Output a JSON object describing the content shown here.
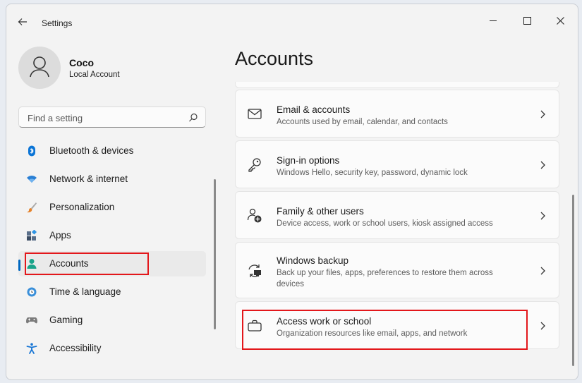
{
  "window": {
    "title": "Settings"
  },
  "profile": {
    "name": "Coco",
    "account_type": "Local Account"
  },
  "search": {
    "placeholder": "Find a setting"
  },
  "nav": {
    "items": [
      {
        "label": "Bluetooth & devices",
        "icon": "bluetooth-icon"
      },
      {
        "label": "Network & internet",
        "icon": "wifi-icon"
      },
      {
        "label": "Personalization",
        "icon": "brush-icon"
      },
      {
        "label": "Apps",
        "icon": "apps-icon"
      },
      {
        "label": "Accounts",
        "icon": "accounts-icon",
        "selected": true
      },
      {
        "label": "Time & language",
        "icon": "globe-clock-icon"
      },
      {
        "label": "Gaming",
        "icon": "gamepad-icon"
      },
      {
        "label": "Accessibility",
        "icon": "accessibility-icon"
      }
    ]
  },
  "main": {
    "title": "Accounts",
    "cards": [
      {
        "title": "Email & accounts",
        "desc": "Accounts used by email, calendar, and contacts",
        "icon": "mail-icon"
      },
      {
        "title": "Sign-in options",
        "desc": "Windows Hello, security key, password, dynamic lock",
        "icon": "key-icon"
      },
      {
        "title": "Family & other users",
        "desc": "Device access, work or school users, kiosk assigned access",
        "icon": "family-icon"
      },
      {
        "title": "Windows backup",
        "desc": "Back up your files, apps, preferences to restore them across devices",
        "icon": "backup-icon"
      },
      {
        "title": "Access work or school",
        "desc": "Organization resources like email, apps, and network",
        "icon": "briefcase-icon"
      }
    ]
  },
  "colors": {
    "accent": "#0067c0",
    "highlight": "#e3171b"
  }
}
